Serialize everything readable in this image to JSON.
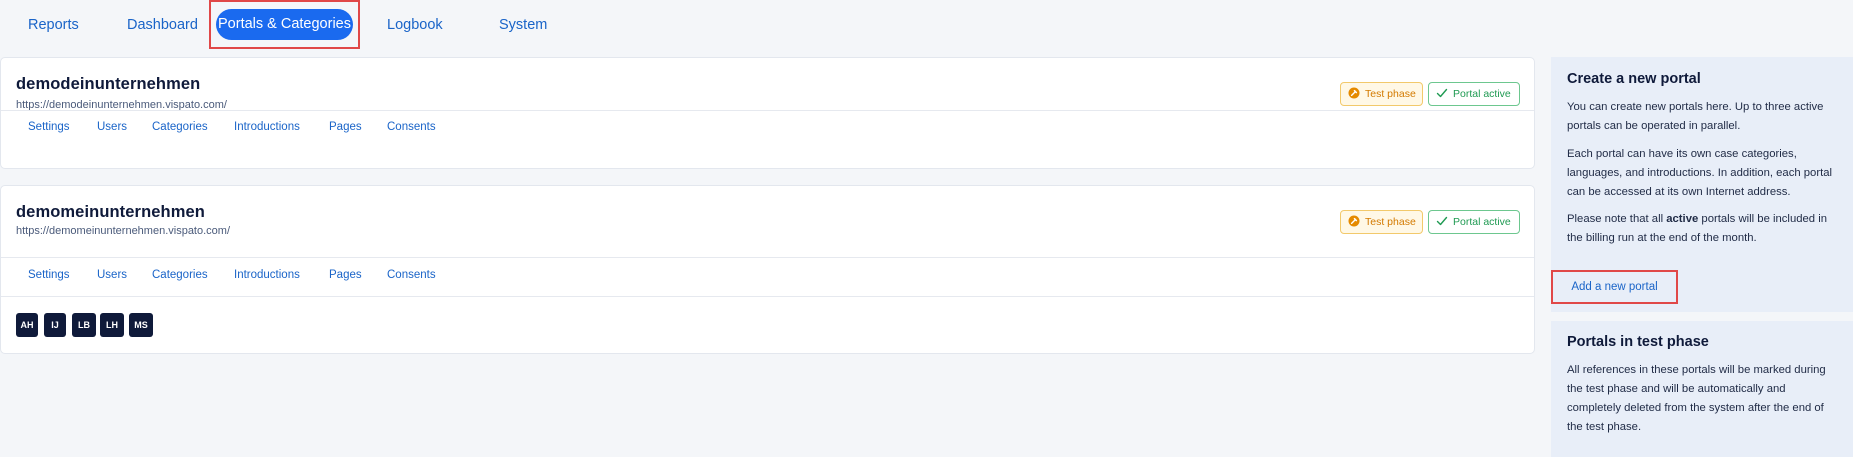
{
  "nav": {
    "tabs": [
      "Reports",
      "Dashboard",
      "Portals & Categories",
      "Logbook",
      "System"
    ],
    "active_tab": "Portals & Categories"
  },
  "portals": [
    {
      "name": "demodeinunternehmen",
      "url": "https://demodeinunternehmen.vispato.com/",
      "badges": {
        "test": "Test phase",
        "active": "Portal active"
      },
      "links": [
        "Settings",
        "Users",
        "Categories",
        "Introductions",
        "Pages",
        "Consents"
      ]
    },
    {
      "name": "demomeinunternehmen",
      "url": "https://demomeinunternehmen.vispato.com/",
      "badges": {
        "test": "Test phase",
        "active": "Portal active"
      },
      "links": [
        "Settings",
        "Users",
        "Categories",
        "Introductions",
        "Pages",
        "Consents"
      ],
      "users": [
        "AH",
        "IJ",
        "LB",
        "LH",
        "MS"
      ]
    }
  ],
  "sidebar": {
    "create": {
      "title": "Create a new portal",
      "p1": "You can create new portals here. Up to three active portals can be operated in parallel.",
      "p2": "Each portal can have its own case categories, languages, and introductions. In addition, each portal can be accessed at its own Internet address.",
      "p3_before": "Please note that all ",
      "p3_bold": "active",
      "p3_after": " portals will be included in the billing run at the end of the month.",
      "button": "Add a new portal"
    },
    "test_phase": {
      "title": "Portals in test phase",
      "text": "All references in these portals will be marked during the test phase and will be automatically and completely deleted from the system after the end of the test phase."
    }
  },
  "colors": {
    "accent": "#1a6aef",
    "link": "#1a64c8",
    "test_badge": "#d37a00",
    "active_badge": "#1f9a52",
    "highlight_border": "#e04848"
  }
}
